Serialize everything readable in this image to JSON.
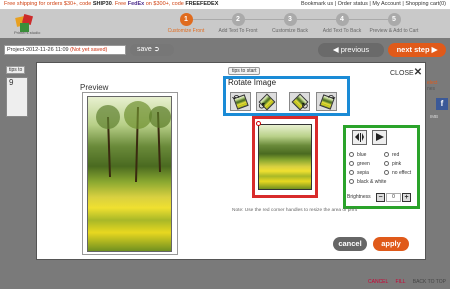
{
  "topbar": {
    "promo_prefix": "Free shipping for orders $30+, code ",
    "promo_code1": "SHIP30",
    "promo_mid": ". Free ",
    "promo_fedex": "FedEx",
    "promo_suffix": " on $300+, code ",
    "promo_code2": "FREEFEDEX",
    "links": [
      "Bookmark us",
      "Order status",
      "My Account",
      "Shopping cart(0)"
    ]
  },
  "logo": {
    "text": "Printer's studio"
  },
  "steps": [
    {
      "num": "1",
      "label": "Customize Front",
      "active": true
    },
    {
      "num": "2",
      "label": "Add Text To Front",
      "active": false
    },
    {
      "num": "3",
      "label": "Customize Back",
      "active": false
    },
    {
      "num": "4",
      "label": "Add Text To Back",
      "active": false
    },
    {
      "num": "5",
      "label": "Preview & Add to Cart",
      "active": false
    }
  ],
  "project": {
    "name": "Project-2012-11-26 11:09",
    "status": "(Not yet saved)"
  },
  "buttons": {
    "save": "save",
    "previous": "previous",
    "next": "next step",
    "cancel": "cancel",
    "apply": "apply",
    "tips_bg": "tips to"
  },
  "background": {
    "card_text": "9",
    "right_label": "elect",
    "right_label2": "nes",
    "facebook": "f",
    "side_text": "IMB"
  },
  "modal": {
    "preview_title": "Preview",
    "tip_button": "tips to start",
    "close_label": "CLOSE",
    "close_icon": "✕",
    "rotate_title": "Rotate Image",
    "effects": [
      "blue",
      "red",
      "green",
      "pink",
      "sepia",
      "no effect",
      "black & white"
    ],
    "brightness_label": "Brightness",
    "brightness_value": "0",
    "minus": "−",
    "plus": "+",
    "note": "Note: Use the red corner handles to resize the area of print"
  },
  "footer": {
    "cancel": "CANCEL",
    "fill": "FILL",
    "back_to_top": "BACK TO TOP"
  },
  "colors": {
    "accent": "#e05a1a",
    "rotate_border": "#1a8bd6",
    "crop_border": "#d82b2b",
    "effect_border": "#2aa32a"
  }
}
